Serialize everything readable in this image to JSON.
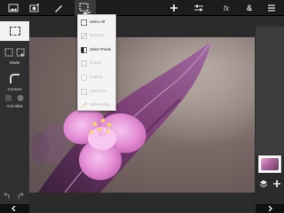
{
  "toolbar": {
    "tools": [
      {
        "icon": "image-icon"
      },
      {
        "icon": "camera-icon"
      },
      {
        "icon": "brush-icon"
      },
      {
        "icon": "selection-icon"
      },
      {
        "icon": "plus-icon"
      },
      {
        "icon": "adjust-icon"
      },
      {
        "icon": "fx-icon",
        "label": "fx"
      },
      {
        "icon": "ampersand-icon",
        "label": "&"
      },
      {
        "icon": "more-icon"
      }
    ]
  },
  "selection_menu": {
    "items": [
      {
        "label": "Select All",
        "enabled": true
      },
      {
        "label": "Deselect",
        "enabled": false
      },
      {
        "label": "Select Pixels",
        "enabled": true
      },
      {
        "label": "Inverse",
        "enabled": false
      },
      {
        "label": "Feather",
        "enabled": false
      },
      {
        "label": "Transform",
        "enabled": false
      },
      {
        "label": "Refine Edge",
        "enabled": false
      }
    ]
  },
  "left_panel": {
    "mode_label": "Mode",
    "corners_label": "Corners",
    "antialias_label": "Anti-alias"
  },
  "colors": {
    "toolbar": "#1c1c1c",
    "panel": "#2f2f2f",
    "menu": "#f4f4f4",
    "flower": "#e7a6dc"
  }
}
